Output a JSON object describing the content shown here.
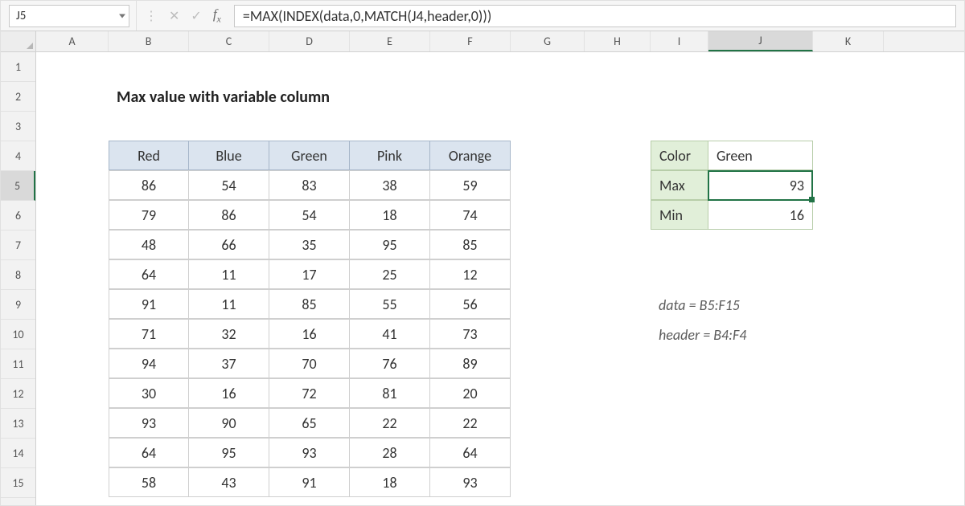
{
  "namebox": "J5",
  "formula": "=MAX(INDEX(data,0,MATCH(J4,header,0)))",
  "columns": [
    "A",
    "B",
    "C",
    "D",
    "E",
    "F",
    "G",
    "H",
    "I",
    "J",
    "K"
  ],
  "active_column_index": 9,
  "row_numbers": [
    1,
    2,
    3,
    4,
    5,
    6,
    7,
    8,
    9,
    10,
    11,
    12,
    13,
    14,
    15
  ],
  "active_row_number": 5,
  "title": "Max value with variable column",
  "table": {
    "headers": [
      "Red",
      "Blue",
      "Green",
      "Pink",
      "Orange"
    ],
    "rows": [
      [
        86,
        54,
        83,
        38,
        59
      ],
      [
        79,
        86,
        54,
        18,
        74
      ],
      [
        48,
        66,
        35,
        95,
        85
      ],
      [
        64,
        11,
        17,
        25,
        12
      ],
      [
        91,
        11,
        85,
        55,
        56
      ],
      [
        71,
        32,
        16,
        41,
        73
      ],
      [
        94,
        37,
        70,
        76,
        89
      ],
      [
        30,
        16,
        72,
        81,
        20
      ],
      [
        93,
        90,
        65,
        22,
        22
      ],
      [
        64,
        95,
        93,
        28,
        64
      ],
      [
        58,
        43,
        91,
        18,
        93
      ]
    ]
  },
  "lookup": {
    "color_label": "Color",
    "color_value": "Green",
    "max_label": "Max",
    "max_value": 93,
    "min_label": "Min",
    "min_value": 16
  },
  "notes": {
    "data_def": "data = B5:F15",
    "header_def": "header = B4:F4"
  },
  "chart_data": {
    "type": "table",
    "title": "Max value with variable column",
    "columns": [
      "Red",
      "Blue",
      "Green",
      "Pink",
      "Orange"
    ],
    "rows": [
      [
        86,
        54,
        83,
        38,
        59
      ],
      [
        79,
        86,
        54,
        18,
        74
      ],
      [
        48,
        66,
        35,
        95,
        85
      ],
      [
        64,
        11,
        17,
        25,
        12
      ],
      [
        91,
        11,
        85,
        55,
        56
      ],
      [
        71,
        32,
        16,
        41,
        73
      ],
      [
        94,
        37,
        70,
        76,
        89
      ],
      [
        30,
        16,
        72,
        81,
        20
      ],
      [
        93,
        90,
        65,
        22,
        22
      ],
      [
        64,
        95,
        93,
        28,
        64
      ],
      [
        58,
        43,
        91,
        18,
        93
      ]
    ],
    "summary": {
      "selected_column": "Green",
      "max": 93,
      "min": 16
    }
  }
}
